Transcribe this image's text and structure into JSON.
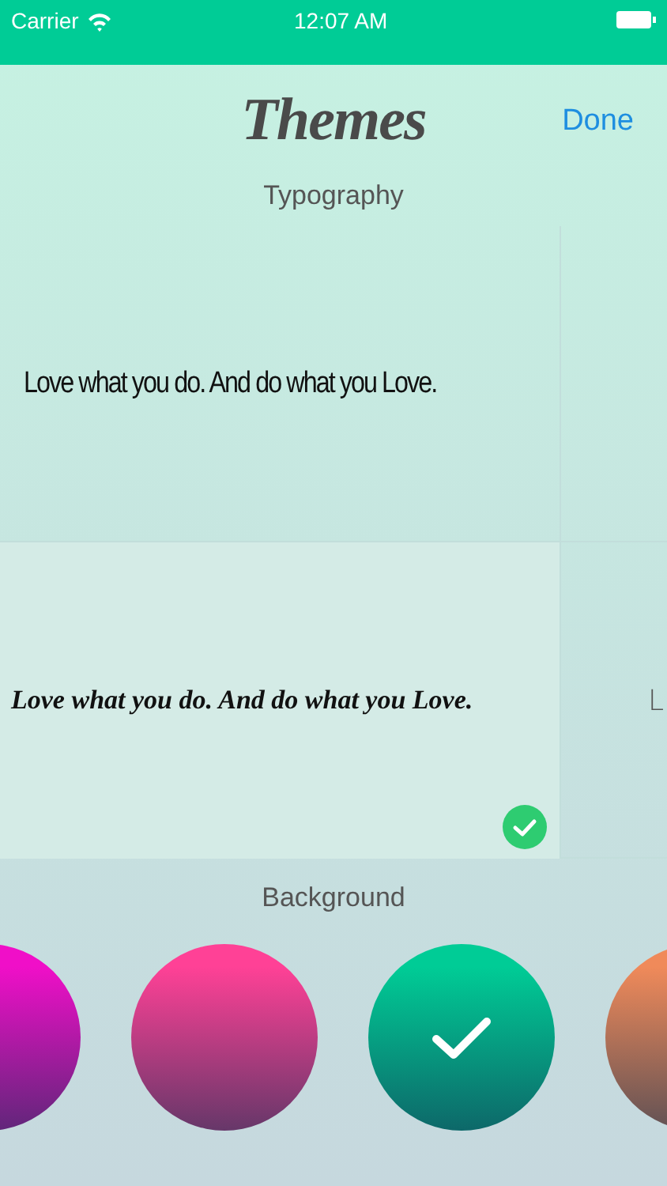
{
  "status_bar": {
    "carrier": "Carrier",
    "time": "12:07 AM"
  },
  "nav": {
    "title": "Themes",
    "done": "Done"
  },
  "typography": {
    "heading": "Typography",
    "rows": [
      {
        "cells": [
          {
            "text": "Love what you do. And do what you Love.",
            "kind": "condensed",
            "selected": false
          }
        ]
      },
      {
        "cells": [
          {
            "text": "Love what you do. And do what you Love.",
            "kind": "script",
            "selected": true
          },
          {
            "text": "L",
            "kind": "thin"
          }
        ]
      }
    ]
  },
  "background": {
    "heading": "Background",
    "swatches": [
      {
        "color": "#f00fc8",
        "selected": false
      },
      {
        "color": "#ff4196",
        "selected": false
      },
      {
        "color": "#00cc96",
        "selected": true
      },
      {
        "color": "#f08a5a"
      }
    ]
  }
}
